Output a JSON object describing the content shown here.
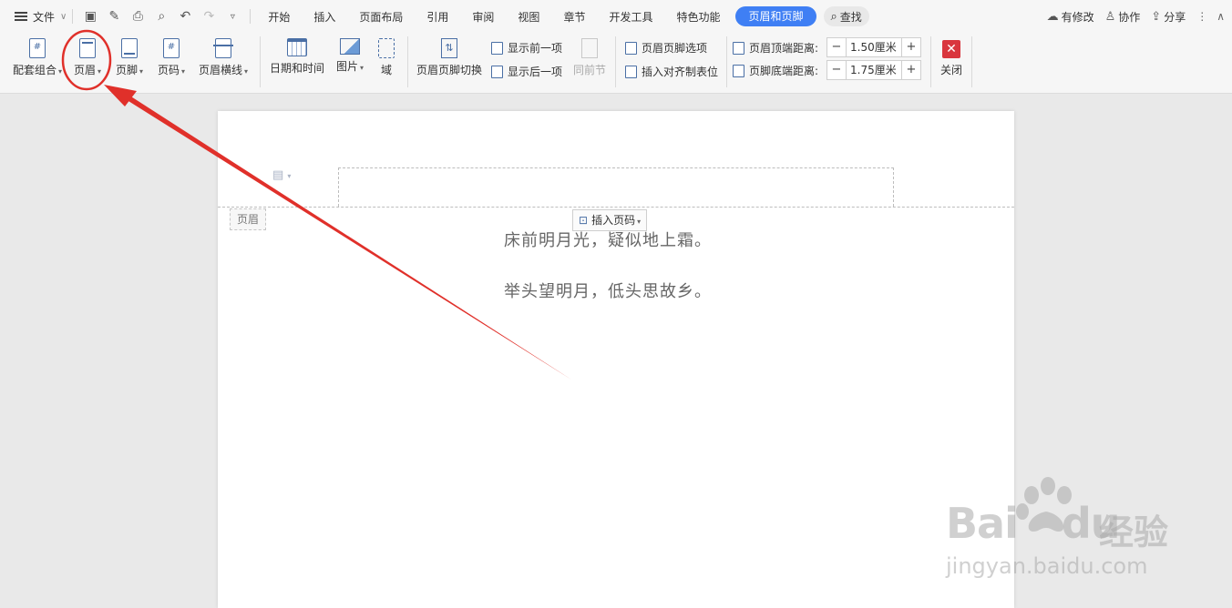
{
  "topbar": {
    "file_label": "文件",
    "tabs": [
      "开始",
      "插入",
      "页面布局",
      "引用",
      "审阅",
      "视图",
      "章节",
      "开发工具",
      "特色功能"
    ],
    "active_tab": "页眉和页脚",
    "search_label": "查找",
    "right": {
      "modified": "有修改",
      "collab": "协作",
      "share": "分享"
    }
  },
  "ribbon": {
    "set_combo": "配套组合",
    "header": "页眉",
    "footer": "页脚",
    "page_number": "页码",
    "header_line": "页眉横线",
    "date_time": "日期和时间",
    "picture": "图片",
    "field": "域",
    "switch": "页眉页脚切换",
    "show_prev": "显示前一项",
    "show_next": "显示后一项",
    "same_as_prev": "同前节",
    "options": "页眉页脚选项",
    "insert_align_tab": "插入对齐制表位",
    "header_top_label": "页眉顶端距离:",
    "header_top_value": "1.50厘米",
    "footer_bottom_label": "页脚底端距离:",
    "footer_bottom_value": "1.75厘米",
    "close": "关闭"
  },
  "document": {
    "header_tag": "页眉",
    "insert_page_number": "插入页码",
    "lines": [
      "床前明月光，疑似地上霜。",
      "举头望明月，低头思故乡。"
    ]
  },
  "watermark": {
    "brand": "Bai",
    "brand2": "du",
    "cn": "经验",
    "url": "jingyan.baidu.com"
  },
  "colors": {
    "accent": "#3f7ff4",
    "annotation": "#e0302a",
    "close": "#d9363e"
  }
}
